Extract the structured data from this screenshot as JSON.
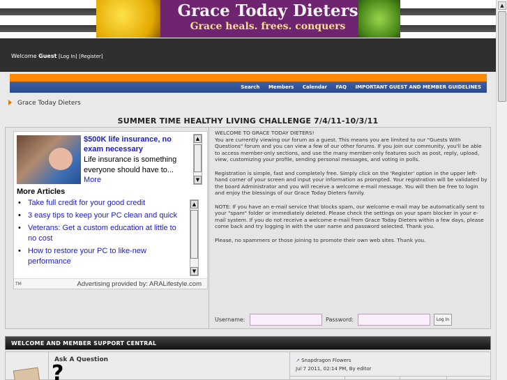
{
  "banner": {
    "title": "Grace Today Dieters",
    "tagline": "Grace heals. frees. conquers"
  },
  "header": {
    "welcome_prefix": "Welcome ",
    "guest": "Guest",
    "login_link": "[Log In]",
    "register_link": "[Register]"
  },
  "nav": {
    "items": [
      "Search",
      "Members",
      "Calendar",
      "FAQ",
      "IMPORTANT GUEST AND MEMBER GUIDELINES"
    ]
  },
  "breadcrumb": "Grace Today Dieters",
  "headline": "SUMMER TIME HEALTHY LIVING CHALLENGE 7/4/11-10/3/11",
  "ad": {
    "headline": "$500K life insurance, no exam necessary",
    "body": "Life insurance is something everyone should have to...",
    "more_link": "More",
    "more_articles_title": "More Articles",
    "articles": [
      "Take full credit for your good credit",
      "3 easy tips to keep your PC clean and quick",
      "Veterans: Get a custom education at little to no cost",
      "How to restore your PC to like-new performance"
    ],
    "tm": "TM",
    "provided_by": "Advertising provided by: ARALifestyle.com"
  },
  "welcome_msg": {
    "p1": "WELCOME TO GRACE TODAY DIETERS!\nYou are currently viewing our forum as a guest. This means you are limited to our \"Guests With Questions\" forum and you can view a few of our other forums. If you join our community, you'll be able to access member-only sections, and use the many member-only features such as post, reply, upload, view, customizing your profile, sending personal messages, and voting in polls.",
    "p2": "Registration is simple, fast and completely free. Simply click on the 'Register' option in the upper left-hand corner of your screen and input your information as prompted. Your registration will be validated by the board Administrator and you will receive a welcome e-mail message. You will then be free to login and enjoy the blessings of our Grace Today Dieters family.",
    "p3": "NOTE: If you have an e-mail service that blocks spam, our welcome e-mail may be automatically sent to your \"spam\" folder or immediately deleted. Please check the settings on your spam blocker in your e-mail system. If you do not receive a welcome e-mail from Grace Today Dieters within a few days, please come back and try logging in with the user name and password selected. Thank you.",
    "p4": "Please, no spammers or those joining to promote their own web sites. Thank you."
  },
  "login": {
    "username_label": "Username:",
    "username_value": "",
    "password_label": "Password:",
    "password_value": "",
    "button": "Log In"
  },
  "support": {
    "section_title": "WELCOME AND MEMBER SUPPORT CENTRAL",
    "forum_title": "Ask A Question",
    "latest_post_title": "Snapdragon Flowers",
    "latest_post_meta": "Jul 7 2011, 02:14 PM, By editor"
  },
  "colors": {
    "accent_orange": "#ff8a00",
    "nav_blue": "#2a4a8c",
    "banner_purple": "#6f246f",
    "link_blue": "#1a1acc"
  }
}
